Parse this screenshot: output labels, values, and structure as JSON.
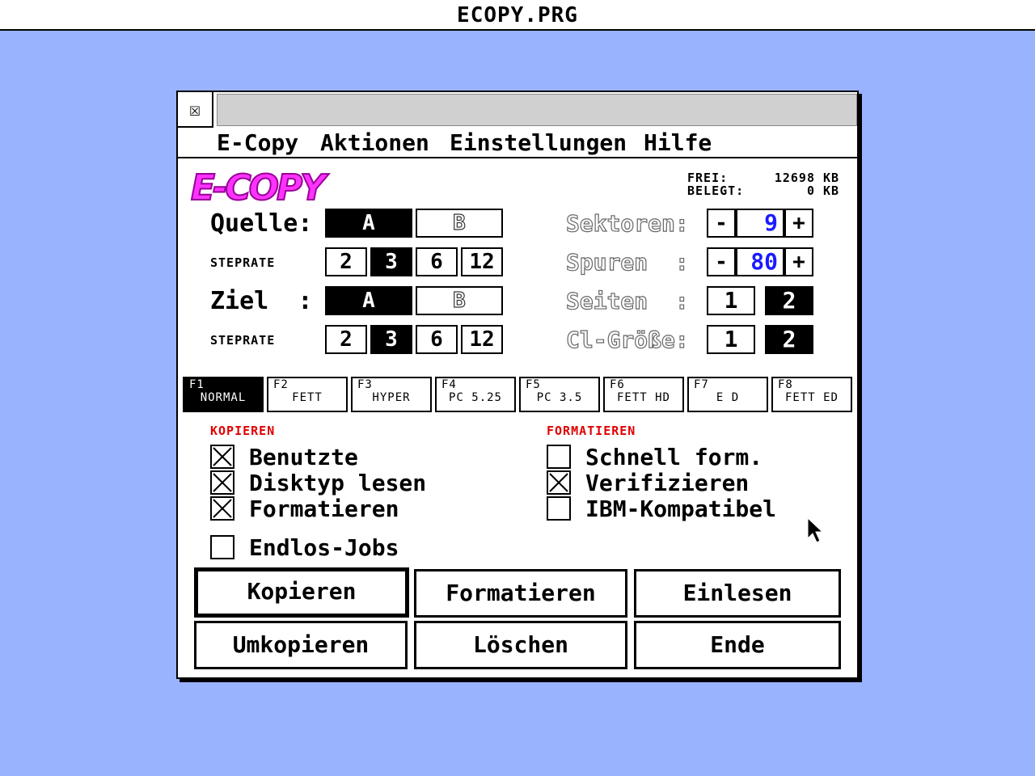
{
  "app": {
    "title": "ECOPY.PRG",
    "logo_text": "E-COPY"
  },
  "window": {
    "close_glyph": "☒"
  },
  "menu": [
    {
      "label": "E-Copy"
    },
    {
      "label": "Aktionen"
    },
    {
      "label": "Einstellungen"
    },
    {
      "label": "Hilfe"
    }
  ],
  "memory": {
    "frei_label": "FREI:",
    "frei_value": "12698",
    "frei_unit": "KB",
    "belegt_label": "BELEGT:",
    "belegt_value": "0",
    "belegt_unit": "KB"
  },
  "source": {
    "label": "Quelle:",
    "drives": [
      {
        "label": "A",
        "selected": true
      },
      {
        "label": "B",
        "selected": false
      }
    ],
    "steprate_label": "STEPRATE",
    "steprates": [
      {
        "label": "2",
        "selected": false
      },
      {
        "label": "3",
        "selected": true
      },
      {
        "label": "6",
        "selected": false
      },
      {
        "label": "12",
        "selected": false
      }
    ]
  },
  "target": {
    "label": "Ziel  :",
    "drives": [
      {
        "label": "A",
        "selected": true
      },
      {
        "label": "B",
        "selected": false
      }
    ],
    "steprate_label": "STEPRATE",
    "steprates": [
      {
        "label": "2",
        "selected": false
      },
      {
        "label": "3",
        "selected": true
      },
      {
        "label": "6",
        "selected": false
      },
      {
        "label": "12",
        "selected": false
      }
    ]
  },
  "format": {
    "sektoren": {
      "label": "Sektoren:",
      "value": "9",
      "minus": "-",
      "plus": "+"
    },
    "spuren": {
      "label": "Spuren  :",
      "value": "80",
      "minus": "-",
      "plus": "+"
    },
    "seiten": {
      "label": "Seiten  :",
      "options": [
        {
          "label": "1",
          "selected": false
        },
        {
          "label": "2",
          "selected": true
        }
      ]
    },
    "cluster": {
      "label": "Cl-Größe:",
      "options": [
        {
          "label": "1",
          "selected": false
        },
        {
          "label": "2",
          "selected": true
        }
      ]
    }
  },
  "fkeys": [
    {
      "key": "F1",
      "label": "NORMAL",
      "selected": true
    },
    {
      "key": "F2",
      "label": "FETT",
      "selected": false
    },
    {
      "key": "F3",
      "label": "HYPER",
      "selected": false
    },
    {
      "key": "F4",
      "label": "PC 5.25",
      "selected": false
    },
    {
      "key": "F5",
      "label": "PC 3.5",
      "selected": false
    },
    {
      "key": "F6",
      "label": "FETT HD",
      "selected": false
    },
    {
      "key": "F7",
      "label": "E D",
      "selected": false
    },
    {
      "key": "F8",
      "label": "FETT ED",
      "selected": false
    }
  ],
  "kopieren_section": {
    "title": "KOPIEREN",
    "options": [
      {
        "label": "Benutzte",
        "checked": true
      },
      {
        "label": "Disktyp lesen",
        "checked": true
      },
      {
        "label": "Formatieren",
        "checked": true
      }
    ]
  },
  "formatieren_section": {
    "title": "FORMATIEREN",
    "options": [
      {
        "label": "Schnell form.",
        "checked": false
      },
      {
        "label": "Verifizieren",
        "checked": true
      },
      {
        "label": "IBM-Kompatibel",
        "checked": false
      }
    ]
  },
  "endlos": {
    "label": "Endlos-Jobs",
    "checked": false
  },
  "buttons": {
    "kopieren": "Kopieren",
    "formatieren": "Formatieren",
    "einlesen": "Einlesen",
    "umkopieren": "Umkopieren",
    "loeschen": "Löschen",
    "ende": "Ende"
  },
  "colors": {
    "desktop": "#99b3ff",
    "section_header": "#e00000",
    "value_blue": "#1a1aff",
    "logo": "#ff33ff"
  }
}
